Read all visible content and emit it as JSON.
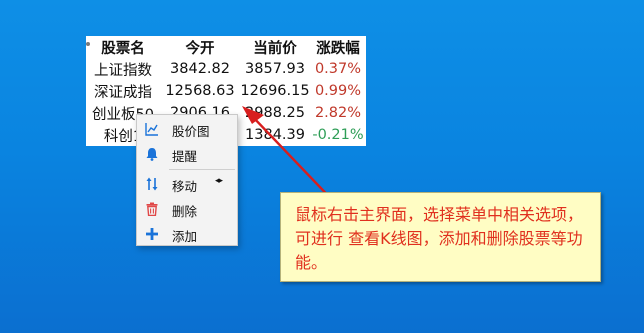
{
  "stock_table": {
    "headers": [
      "股票名",
      "今开",
      "当前价",
      "涨跌幅"
    ],
    "rows": [
      {
        "name": "上证指数",
        "open": "3842.82",
        "current": "3857.93",
        "change": "0.37%"
      },
      {
        "name": "深证成指",
        "open": "12568.63",
        "current": "12696.15",
        "change": "0.99%"
      },
      {
        "name": "创业板50",
        "open": "2906.16",
        "current": "2988.25",
        "change": "2.82%"
      },
      {
        "name": "科创1",
        "open": "",
        "current": "1384.39",
        "change": "-0.21%"
      }
    ]
  },
  "context_menu": {
    "items": [
      {
        "label": "股价图",
        "icon": "line-chart-icon"
      },
      {
        "label": "提醒",
        "icon": "bell-icon"
      },
      {
        "label": "移动",
        "icon": "up-down-arrows-icon",
        "submenu_arrow": "◂▸"
      },
      {
        "label": "删除",
        "icon": "trash-icon"
      },
      {
        "label": "添加",
        "icon": "plus-icon"
      }
    ]
  },
  "callout": {
    "text": "鼠标右击主界面，选择菜单中相关选项，可进行 查看K线图，添加和删除股票等功能。"
  },
  "colors": {
    "desktop_bg": "#0a84e0",
    "up": "#c0392b",
    "down": "#2e9e57",
    "callout_bg": "#fffdc4",
    "callout_text": "#e0301e",
    "arrow": "#d81e1e",
    "icon_blue": "#1a73d9",
    "icon_red": "#e04848"
  }
}
